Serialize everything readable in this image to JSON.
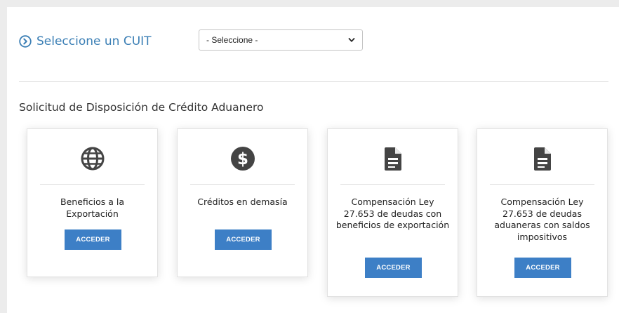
{
  "header": {
    "cuit_label": "Seleccione un CUIT",
    "cuit_select_value": "- Seleccione -"
  },
  "section": {
    "title": "Solicitud de Disposición de Crédito Aduanero"
  },
  "cards": [
    {
      "icon": "globe-icon",
      "title": "Beneficios a la Exportación",
      "button_label": "ACCEDER"
    },
    {
      "icon": "dollar-circle-icon",
      "title": "Créditos en demasía",
      "button_label": "ACCEDER"
    },
    {
      "icon": "document-icon",
      "title": "Compensación Ley 27.653 de deudas con beneficios de exportación",
      "button_label": "ACCEDER"
    },
    {
      "icon": "document-icon",
      "title": "Compensación Ley 27.653 de deudas aduaneras con saldos impositivos",
      "button_label": "ACCEDER"
    }
  ],
  "colors": {
    "accent_link": "#3b7fb5",
    "button": "#3d7fc6",
    "icon": "#444444"
  }
}
